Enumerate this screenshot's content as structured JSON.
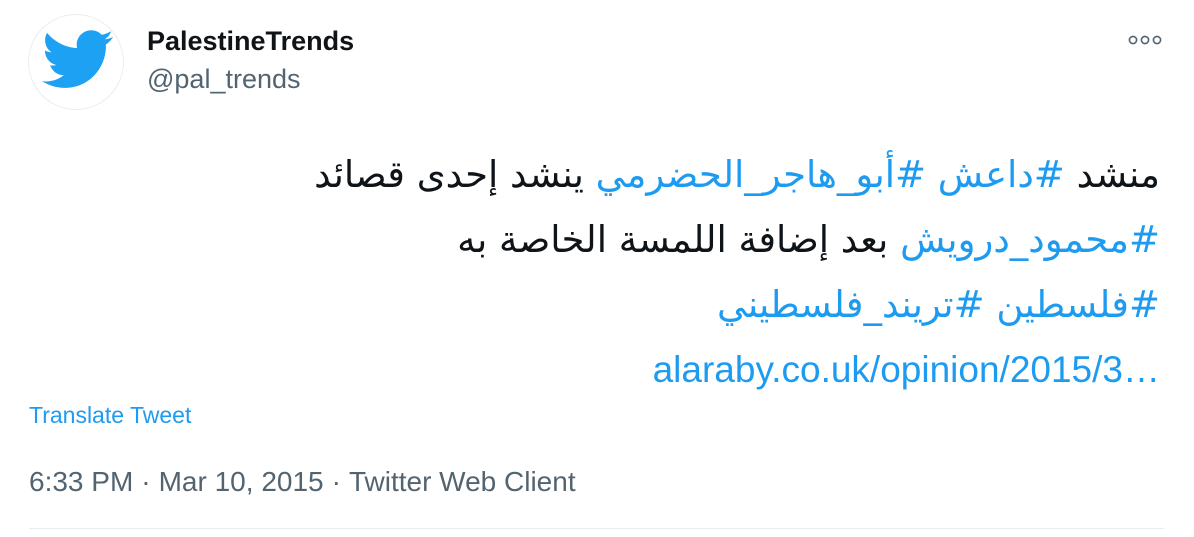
{
  "user": {
    "display_name": "PalestineTrends",
    "handle": "@pal_trends",
    "avatar_icon": "twitter-bird-icon"
  },
  "more_icon": "more-options-icon",
  "tweet": {
    "line1": {
      "t1": "منشد ",
      "h1": "#داعش",
      "t2": " ",
      "h2": "#أبو_هاجر_الحضرمي",
      "t3": " ينشد إحدى قصائد"
    },
    "line2": {
      "h1": "#محمود_درويش",
      "t1": " بعد إضافة اللمسة الخاصة به"
    },
    "line3": {
      "h1": "#فلسطين",
      "t1": " ",
      "h2": "#تريند_فلسطيني"
    },
    "link": "alaraby.co.uk/opinion/2015/3…"
  },
  "translate_label": "Translate Tweet",
  "meta": {
    "time": "6:33 PM",
    "separator": "·",
    "date": "Mar 10, 2015",
    "client": "Twitter Web Client"
  },
  "colors": {
    "accent": "#1d9bf0",
    "text": "#0f1419",
    "secondary": "#536471"
  }
}
